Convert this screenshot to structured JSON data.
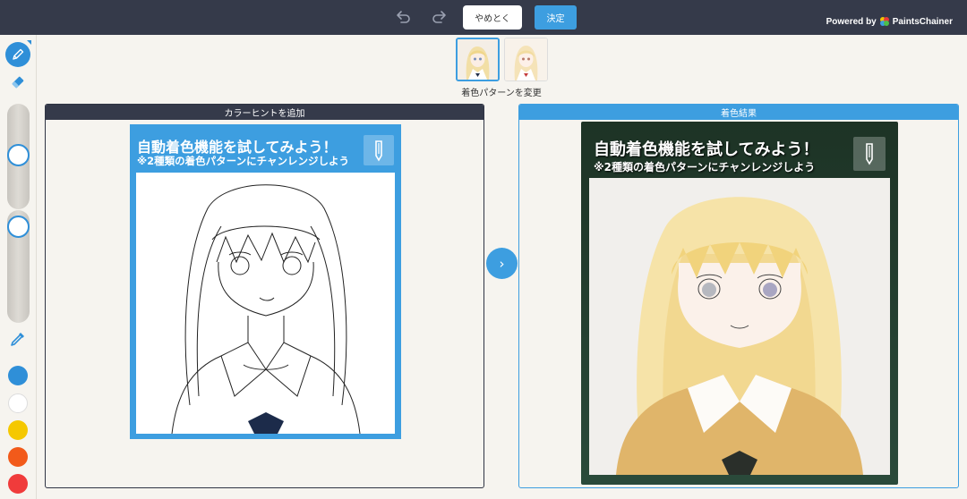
{
  "topbar": {
    "cancel_label": "やめとく",
    "ok_label": "決定",
    "powered_by": "Powered by",
    "brand": "PaintsChainer"
  },
  "toolbar": {
    "tools": [
      "pencil-icon",
      "eraser-icon",
      "eyedropper-icon"
    ],
    "swatches": [
      "#2f8fd8",
      "#ffffff",
      "#f5c800",
      "#f25a1a",
      "#f03b3b"
    ]
  },
  "patterns": {
    "label": "着色パターンを変更"
  },
  "left_panel": {
    "title": "カラーヒントを追加",
    "banner_line1": "自動着色機能を試してみよう！",
    "banner_line2": "※2種類の着色パターンにチャンレンジしよう"
  },
  "right_panel": {
    "title": "着色結果",
    "banner_line1": "自動着色機能を試してみよう！",
    "banner_line2": "※2種類の着色パターンにチャンレンジしよう"
  },
  "colors": {
    "accent": "#3d9ee0",
    "topbar": "#353a4a",
    "background": "#f6f4ef"
  }
}
